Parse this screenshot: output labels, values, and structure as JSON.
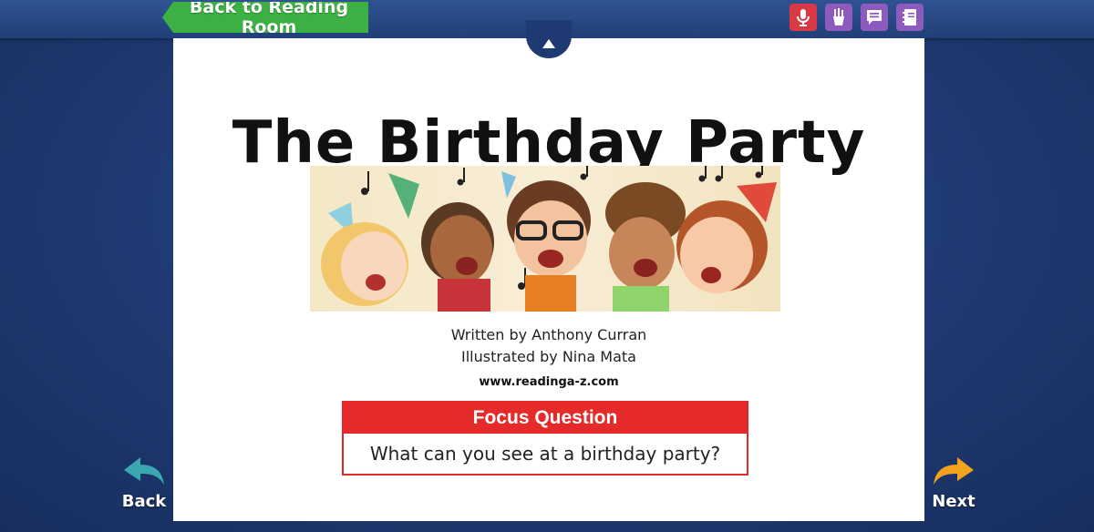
{
  "header": {
    "back_to_room_label": "Back to Reading Room",
    "tools": [
      "microphone-icon",
      "pencil-cup-icon",
      "comment-icon",
      "notebook-icon"
    ]
  },
  "book": {
    "title": "The Birthday Party",
    "author_line": "Written by Anthony Curran",
    "illustrator_line": "Illustrated by Nina Mata",
    "url": "www.readinga-z.com",
    "focus_label": "Focus Question",
    "focus_question": "What can you see at a birthday party?"
  },
  "nav": {
    "back_label": "Back",
    "next_label": "Next"
  },
  "colors": {
    "green": "#3cb043",
    "red": "#e52a2a",
    "purple": "#8c5bbd",
    "navy": "#1f3a72",
    "arrow_back": "#3aa6b0",
    "arrow_next": "#f2a21c"
  }
}
